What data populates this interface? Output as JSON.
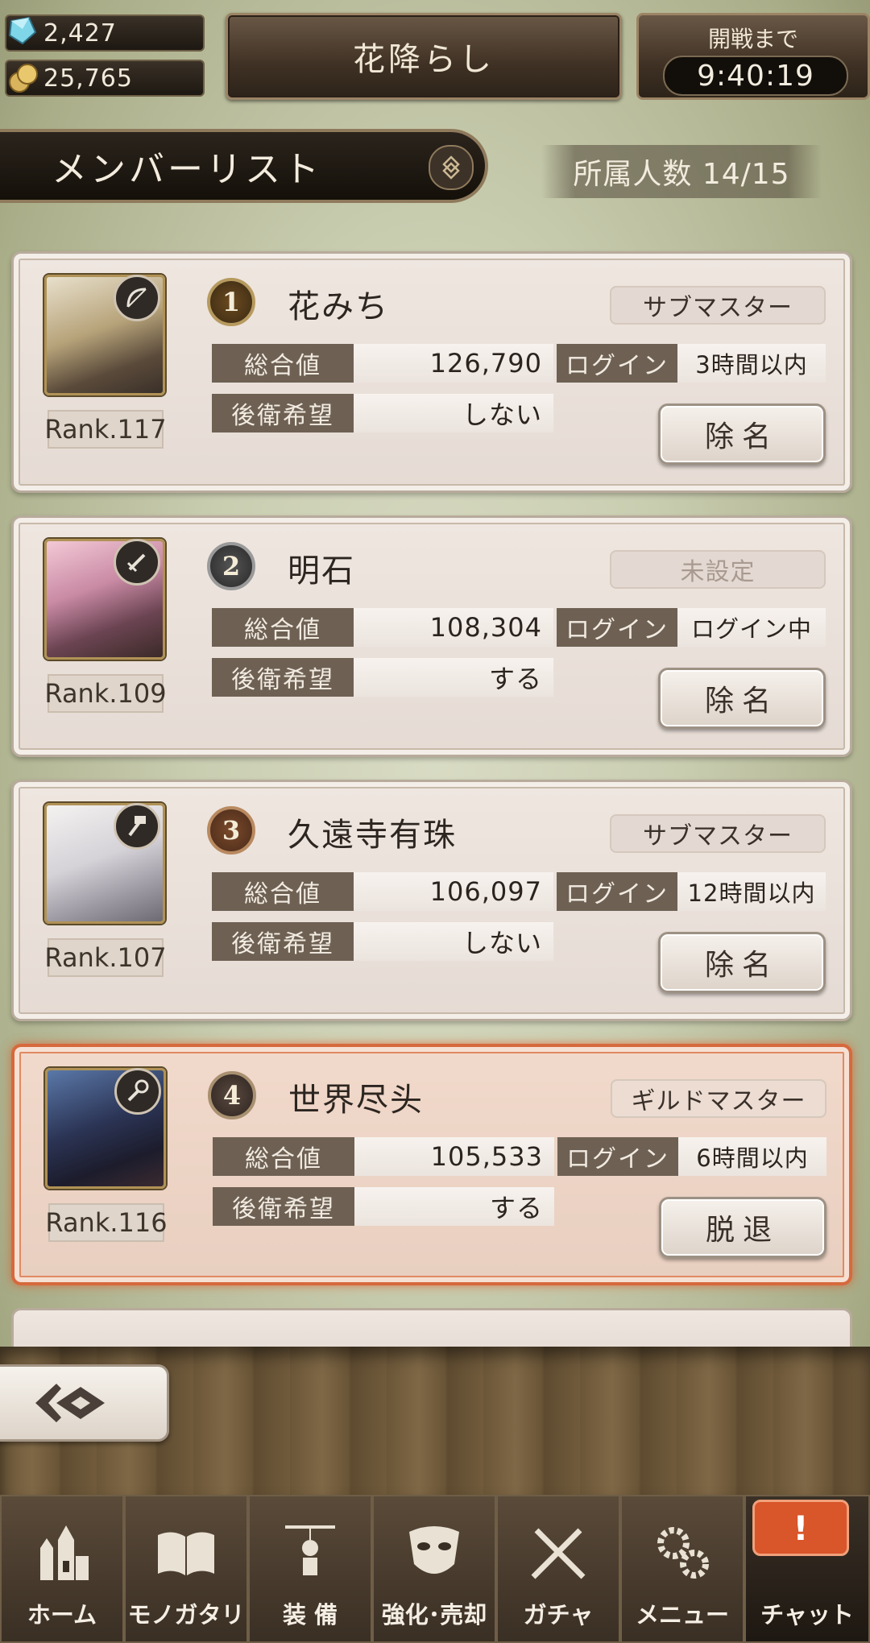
{
  "header": {
    "gems": "2,427",
    "coins": "25,765",
    "guild_name": "花降らし",
    "battle_label": "開戦まで",
    "battle_timer": "9:40:19"
  },
  "list": {
    "title": "メンバーリスト",
    "member_count": "所属人数 14/15"
  },
  "labels": {
    "power": "総合値",
    "login": "ログイン",
    "backline": "後衛希望"
  },
  "members": [
    {
      "rank_no": "1",
      "name": "花みち",
      "role": "サブマスター",
      "power": "126,790",
      "login": "3時間以内",
      "backline": "しない",
      "level": "Rank.117",
      "action": "除名",
      "class_icon": "bow-icon"
    },
    {
      "rank_no": "2",
      "name": "明石",
      "role": "未設定",
      "power": "108,304",
      "login": "ログイン中",
      "backline": "する",
      "level": "Rank.109",
      "action": "除名",
      "class_icon": "sword-icon"
    },
    {
      "rank_no": "3",
      "name": "久遠寺有珠",
      "role": "サブマスター",
      "power": "106,097",
      "login": "12時間以内",
      "backline": "しない",
      "level": "Rank.107",
      "action": "除名",
      "class_icon": "hammer-icon"
    },
    {
      "rank_no": "4",
      "name": "世界尽头",
      "role": "ギルドマスター",
      "power": "105,533",
      "login": "6時間以内",
      "backline": "する",
      "level": "Rank.116",
      "action": "脱退",
      "class_icon": "staff-icon"
    }
  ],
  "nav": [
    {
      "label": "ホーム",
      "icon": "castle-icon"
    },
    {
      "label": "モノガタリ",
      "icon": "book-icon"
    },
    {
      "label": "装 備",
      "icon": "puppet-icon"
    },
    {
      "label": "強化･売却",
      "icon": "mask-icon"
    },
    {
      "label": "ガチャ",
      "icon": "crossed-swords-icon"
    },
    {
      "label": "メニュー",
      "icon": "gear-icon"
    },
    {
      "label": "チャット",
      "icon": "chat-icon",
      "badge": "!"
    }
  ],
  "colors": {
    "self_highlight": "#d6693d",
    "stat_label_bg": "#6e6154",
    "rank1_medal": "#3a2a14",
    "rank2_medal": "#3a3838",
    "rank3_medal": "#4a2a1a",
    "rank4_medal": "#3a2e28"
  }
}
